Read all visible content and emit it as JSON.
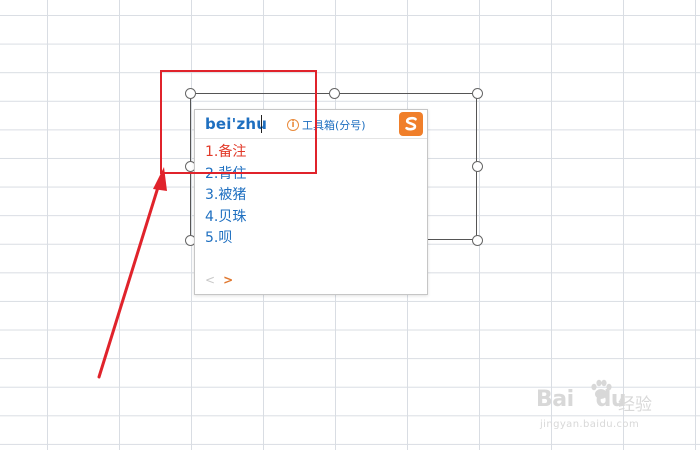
{
  "ime": {
    "pinyin": "bei'zhu",
    "toolbox_label": "工具箱(分号)",
    "info_glyph": "i",
    "logo_glyph": "S",
    "candidates": [
      "1.备注",
      "2.背住",
      "3.被猪",
      "4.贝珠",
      "5.呗"
    ],
    "pager_prev": "<",
    "pager_next": ">"
  },
  "watermark": {
    "brand_left": "Bai",
    "brand_right": "du",
    "cn_text": "经验",
    "url": "jingyan.baidu.com"
  },
  "colors": {
    "highlight": "#e0232b",
    "candidate_active": "#e23a2a",
    "candidate": "#1e6fc0",
    "sogou_orange": "#f07f2a"
  },
  "icons": [
    "info-icon",
    "sogou-logo-icon",
    "paw-icon",
    "arrow-annotation"
  ]
}
